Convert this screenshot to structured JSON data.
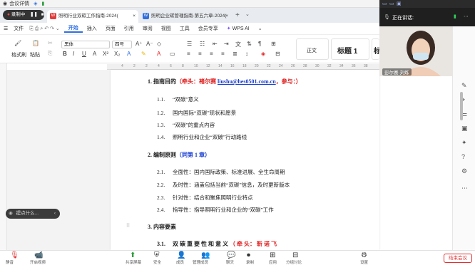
{
  "meeting": {
    "app_title": "会议详情",
    "recording_label": "录制中",
    "speaking_label": "正在讲话:",
    "camera_name": "彭尔赛·刘炼",
    "end_button": "结束会议",
    "bottom_tools": [
      "静音",
      "开启视频",
      "共享屏幕",
      "安全",
      "成员",
      "管理成员",
      "聊天",
      "录制",
      "应用",
      "分组讨论",
      "设置"
    ]
  },
  "browser": {
    "tabs": [
      {
        "label": "照明行业双碳工作指南-2024(",
        "active": true
      },
      {
        "label": "照明企业碳管理指南-第五六章-2024(",
        "active": false
      }
    ],
    "new_tab": "+"
  },
  "ribbon": {
    "file_menu": "文件",
    "menus": [
      "开始",
      "插入",
      "页面",
      "引用",
      "审阅",
      "视图",
      "工具",
      "会员专享"
    ],
    "active_menu": "开始",
    "ai_label": "WPS AI",
    "format_painter": "格式刷",
    "paste": "粘贴",
    "font_name": "黑体",
    "font_size": "四号",
    "style_body": "正文",
    "style_h1": "标题 1",
    "style_h2": "标"
  },
  "ruler_ticks": [
    "4",
    "2",
    "2",
    "4",
    "6",
    "8",
    "10",
    "12",
    "14",
    "16",
    "18",
    "20",
    "22",
    "24",
    "26",
    "28",
    "30",
    "32",
    "34",
    "36",
    "38"
  ],
  "document": {
    "h1_num": "1.",
    "h1_title": "指南目的",
    "h1_lead": "（牵头：",
    "h1_name": "褚尔赛",
    "h1_email": "liushu@hes0501.com.cn",
    "h1_tail": "，参与：）",
    "s1": [
      {
        "num": "1.1.",
        "text": "“双碳”意义"
      },
      {
        "num": "1.2.",
        "text": "国内国际“双碳”现状和愿景"
      },
      {
        "num": "1.3.",
        "text": "“双碳”的重点内容"
      },
      {
        "num": "1.4.",
        "text": "照明行业和企业“双碳”行动路线"
      }
    ],
    "h2_num": "2.",
    "h2_title": "编制原则",
    "h2_note": "（同第 1 章）",
    "s2": [
      {
        "num": "2.1.",
        "text": "全面性：国内国际政策、标准进展、全生命周期"
      },
      {
        "num": "2.2.",
        "text": "及时性：涵盖包括当前“双碳”信息，及时更新版本"
      },
      {
        "num": "2.3.",
        "text": "针对性：结合和聚焦照明行业特点"
      },
      {
        "num": "2.4.",
        "text": "指导性：指导照明行业和企业的“双碳”工作"
      }
    ],
    "h3_num": "3.",
    "h3_title": "内容要素",
    "s3_num": "3.1.",
    "s3_title": "双 碳 重 要 性 和 意 义",
    "s3_note": "（ 牵 头： 靳 诺 飞"
  },
  "assistant": {
    "label": "提点什么..."
  },
  "colors": {
    "accent": "#2f6fe0",
    "heading_red": "#e02020",
    "heading_blue": "#1a3fd0",
    "end_red": "#e03131"
  }
}
